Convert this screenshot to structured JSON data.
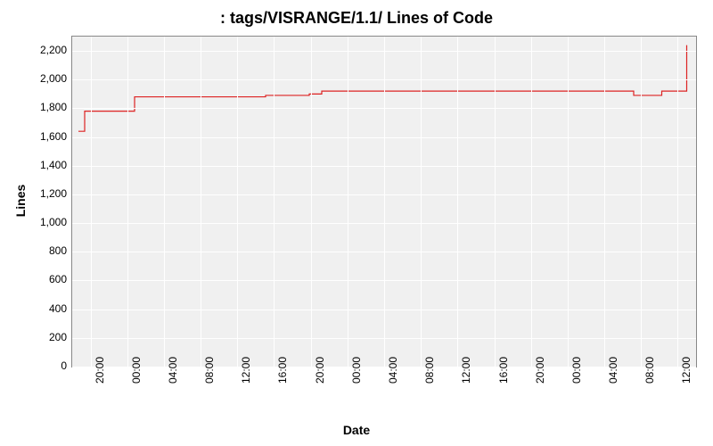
{
  "chart_data": {
    "type": "line",
    "title": ": tags/VISRANGE/1.1/ Lines of Code",
    "xlabel": "Date",
    "ylabel": "Lines",
    "ylim": [
      0,
      2300
    ],
    "yticks": [
      0,
      200,
      400,
      600,
      800,
      1000,
      1200,
      1400,
      1600,
      1800,
      2000,
      2200
    ],
    "xticks": [
      "20:00",
      "00:00",
      "04:00",
      "08:00",
      "12:00",
      "16:00",
      "20:00",
      "00:00",
      "04:00",
      "08:00",
      "12:00",
      "16:00",
      "20:00",
      "00:00",
      "04:00",
      "08:00",
      "12:00"
    ],
    "series": [
      {
        "name": "loc",
        "color": "#d22",
        "points": [
          {
            "x": 0.01,
            "y": 1640
          },
          {
            "x": 0.02,
            "y": 1780
          },
          {
            "x": 0.095,
            "y": 1780
          },
          {
            "x": 0.1,
            "y": 1880
          },
          {
            "x": 0.3,
            "y": 1880
          },
          {
            "x": 0.31,
            "y": 1890
          },
          {
            "x": 0.38,
            "y": 1900
          },
          {
            "x": 0.4,
            "y": 1920
          },
          {
            "x": 0.88,
            "y": 1920
          },
          {
            "x": 0.9,
            "y": 1890
          },
          {
            "x": 0.94,
            "y": 1890
          },
          {
            "x": 0.945,
            "y": 1920
          },
          {
            "x": 0.98,
            "y": 1920
          },
          {
            "x": 0.985,
            "y": 2240
          }
        ]
      }
    ]
  }
}
